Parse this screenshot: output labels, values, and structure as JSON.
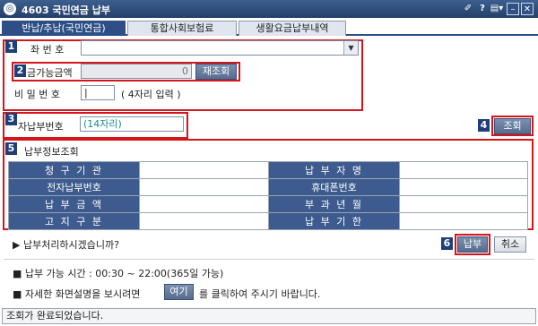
{
  "window": {
    "title": "4603 국민연금 납부",
    "app_icon": "app-logo-icon",
    "controls": {
      "pin": "✐",
      "help": "?",
      "menu": "▤▾",
      "minimize": "–",
      "maximize": "□",
      "close": "✕"
    }
  },
  "tabs": [
    {
      "label": "반납/추납(국민연금)"
    },
    {
      "label": "통합사회보험료"
    },
    {
      "label": "생활요금납부내역"
    }
  ],
  "markers": [
    "1",
    "2",
    "3",
    "4",
    "5",
    "6"
  ],
  "form": {
    "account_label": "좌 번 호",
    "available_label": "금가능금액",
    "available_value": "0",
    "inquire_label": "재조회",
    "password_label": "비 밀 번 호",
    "password_hint": "( 4자리 입력 )",
    "epay_label": "자납부번호",
    "epay_placeholder": "(14자리)",
    "lookup_label": "조회"
  },
  "info": {
    "title": "납부정보조회",
    "rows": [
      [
        "청 구 기 관",
        "납 부 자 명"
      ],
      [
        "전자납부번호",
        "휴대폰번호"
      ],
      [
        "납 부 금 액",
        "부 과 년 월"
      ],
      [
        "고 지 구 분",
        "납 부 기 한"
      ]
    ]
  },
  "confirm": {
    "question": "▶ 납부처리하시겠습니까?",
    "pay_label": "납부",
    "cancel_label": "취소"
  },
  "notes": {
    "hours": "■ 납부 가능 시간 : 00:30 ~ 22:00(365일 가능)",
    "help_prefix": "■ 자세한 화면설명을 보시려면",
    "help_link": "여기",
    "help_suffix": "를 클릭하여 주시기 바랍니다."
  },
  "status": {
    "text": "조회가 완료되었습니다."
  }
}
